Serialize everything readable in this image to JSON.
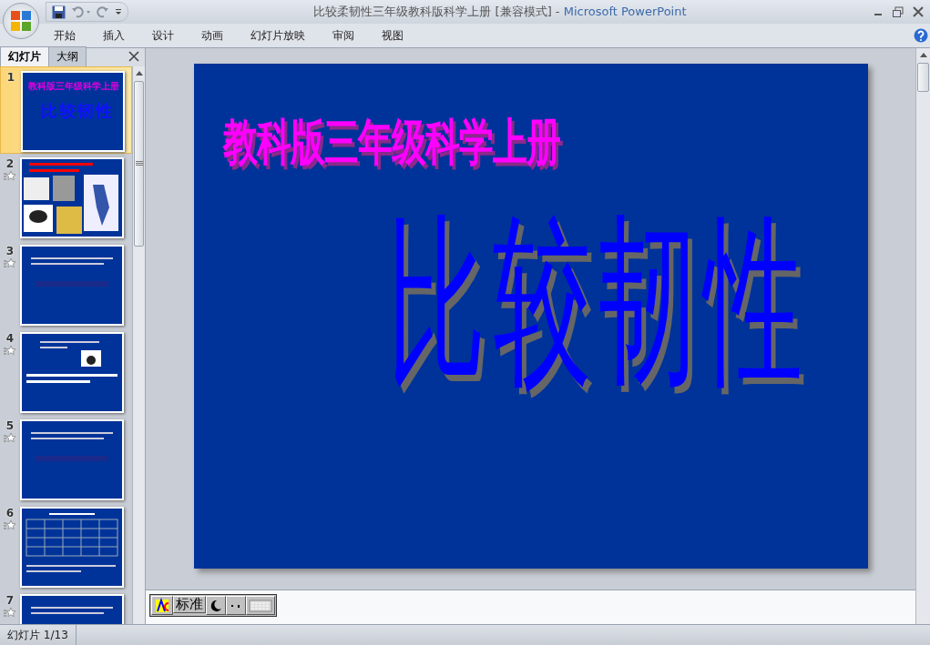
{
  "window": {
    "title": "比较柔韧性三年级教科版科学上册 [兼容模式]",
    "separator": "-",
    "app_name": "Microsoft PowerPoint"
  },
  "ribbon_tabs": [
    {
      "label": "开始"
    },
    {
      "label": "插入"
    },
    {
      "label": "设计"
    },
    {
      "label": "动画"
    },
    {
      "label": "幻灯片放映"
    },
    {
      "label": "审阅"
    },
    {
      "label": "视图"
    }
  ],
  "pane_tabs": [
    {
      "label": "幻灯片",
      "selected": true
    },
    {
      "label": "大纲",
      "selected": false
    }
  ],
  "slides": [
    {
      "number": "1",
      "selected": true,
      "animated": false,
      "kind": "title",
      "texts": [
        "教科版三年级科学上册",
        "比较韧性"
      ]
    },
    {
      "number": "2",
      "selected": false,
      "animated": true,
      "kind": "pictures"
    },
    {
      "number": "3",
      "selected": false,
      "animated": true,
      "kind": "text"
    },
    {
      "number": "4",
      "selected": false,
      "animated": true,
      "kind": "picture_text"
    },
    {
      "number": "5",
      "selected": false,
      "animated": true,
      "kind": "text"
    },
    {
      "number": "6",
      "selected": false,
      "animated": true,
      "kind": "table"
    },
    {
      "number": "7",
      "selected": false,
      "animated": true,
      "kind": "text"
    }
  ],
  "slide": {
    "title": "教科版三年级科学上册",
    "heading": "比较韧性"
  },
  "ime_toolbar": {
    "mode": "标准"
  },
  "status_bar": {
    "slide_indicator": "幻灯片 1/13"
  }
}
